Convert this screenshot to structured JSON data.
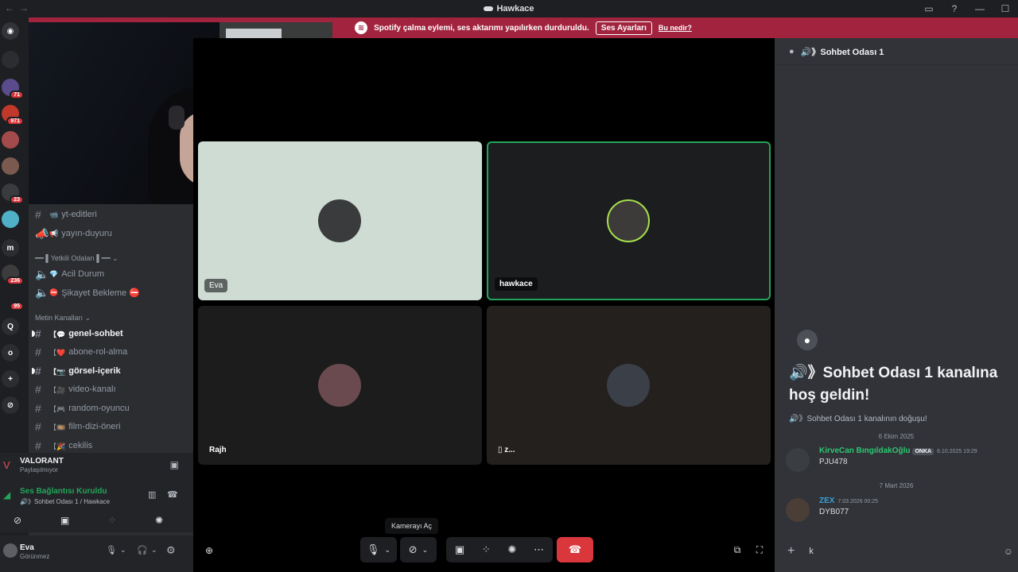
{
  "window": {
    "title": "Hawkace"
  },
  "notice": {
    "text": "Spotify çalma eylemi, ses aktarımı yapılırken durduruldu.",
    "button": "Ses Ayarları",
    "link": "Bu nedir?"
  },
  "rail": {
    "servers": [
      {
        "label": "",
        "badge": ""
      },
      {
        "label": "",
        "badge": "71"
      },
      {
        "label": "",
        "badge": "971"
      },
      {
        "label": "",
        "badge": ""
      },
      {
        "label": "",
        "badge": ""
      },
      {
        "label": "",
        "badge": "23"
      },
      {
        "label": "",
        "badge": ""
      },
      {
        "label": "m",
        "badge": ""
      },
      {
        "label": "",
        "badge": "236"
      },
      {
        "label": "",
        "badge": "95"
      },
      {
        "label": "Q",
        "badge": ""
      },
      {
        "label": "o",
        "badge": ""
      },
      {
        "label": "+",
        "badge": ""
      },
      {
        "label": "⊘",
        "badge": ""
      }
    ]
  },
  "sidebar": {
    "channels_top": [
      {
        "icon": "#",
        "name": "yt-editleri",
        "prefix": "📹"
      },
      {
        "icon": "📢",
        "name": "yayın-duyuru",
        "prefix": "📢"
      }
    ],
    "category_yetkili": "━━ ▌Yetkili Odaları ▌━━",
    "voice_channels": [
      {
        "name": "Acil Durum",
        "prefix": "💎"
      },
      {
        "name": "Şikayet Bekleme ⛔",
        "prefix": "⛔"
      }
    ],
    "category_metin": "Metin Kanalları",
    "text_channels": [
      {
        "name": "genel-sohbet",
        "prefix": "【💬",
        "bold": true,
        "unread": true
      },
      {
        "name": "abone-rol-alma",
        "prefix": "【❤️",
        "bold": false,
        "unread": false
      },
      {
        "name": "görsel-içerik",
        "prefix": "【📷",
        "bold": true,
        "unread": true
      },
      {
        "name": "video-kanalı",
        "prefix": "【🎥",
        "bold": false,
        "unread": false
      },
      {
        "name": "random-oyuncu",
        "prefix": "【🎮",
        "bold": false,
        "unread": false
      },
      {
        "name": "film-dizi-öneri",
        "prefix": "【🎞️",
        "bold": false,
        "unread": false
      },
      {
        "name": "cekilis",
        "prefix": "【🎉",
        "bold": false,
        "unread": false
      }
    ]
  },
  "activity": {
    "game": "VALORANT",
    "status": "Paylaşılmıyor"
  },
  "connection": {
    "status": "Ses Bağlantısı Kuruldu",
    "channel": "🔊》Sohbet Odası 1 / Hawkace"
  },
  "user": {
    "name": "Eva",
    "status": "Görünmez"
  },
  "tiles": [
    {
      "name": "Eva",
      "bg": "#cfdcd4"
    },
    {
      "name": "hawkace",
      "bg": "#1c1d1f"
    },
    {
      "name": "Rajh",
      "bg": "#1c1c1c"
    },
    {
      "name": "z...",
      "bg": "#23201e"
    }
  ],
  "tooltip": "Kamerayı Aç",
  "chat": {
    "header": "🔊》Sohbet Odası 1",
    "welcome": "🔊》Sohbet Odası 1 kanalına hoş geldin!",
    "origin": "🔊》Sohbet Odası 1 kanalının doğuşu!",
    "dividers": [
      "6 Ekim 2025",
      "7 Mart 2026"
    ],
    "messages": [
      {
        "author": "KirveCan BıngıldakOğlu",
        "author_color": "#2dc770",
        "tag": "ONKA",
        "time": "6.10.2025 19:29",
        "text": "PJU478"
      },
      {
        "author": "ZEX",
        "author_color": "#3ba0d6",
        "tag": "",
        "time": "7.03.2026 00:25",
        "text": "DYB077"
      }
    ],
    "input_value": "k"
  },
  "colors": {
    "accent": "#5865f2",
    "danger": "#da373c",
    "speaking": "#23a559",
    "notice": "#a1233e"
  }
}
